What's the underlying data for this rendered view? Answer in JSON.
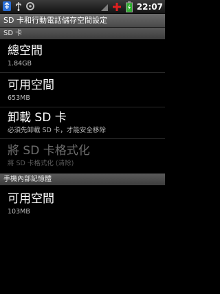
{
  "status_bar": {
    "time": "22:07",
    "left_icons": [
      "usb-icon",
      "usb-debug-icon",
      "android-debug-icon"
    ],
    "right_icons": [
      "signal-icon",
      "alert-icon",
      "battery-charging-icon"
    ]
  },
  "title": "SD 卡和行動電話儲存空間設定",
  "sections": {
    "sd_card": {
      "header": "SD 卡",
      "total_space": {
        "title": "總空間",
        "value": "1.84GB"
      },
      "available_space": {
        "title": "可用空間",
        "value": "653MB"
      },
      "unmount": {
        "title": "卸載 SD 卡",
        "summary": "必須先卸載 SD 卡，才能安全移除"
      },
      "format": {
        "title": "將 SD 卡格式化",
        "summary": "將 SD 卡格式化 (清除)"
      }
    },
    "internal": {
      "header": "手機內部記憶體",
      "available_space": {
        "title": "可用空間",
        "value": "103MB"
      }
    }
  }
}
